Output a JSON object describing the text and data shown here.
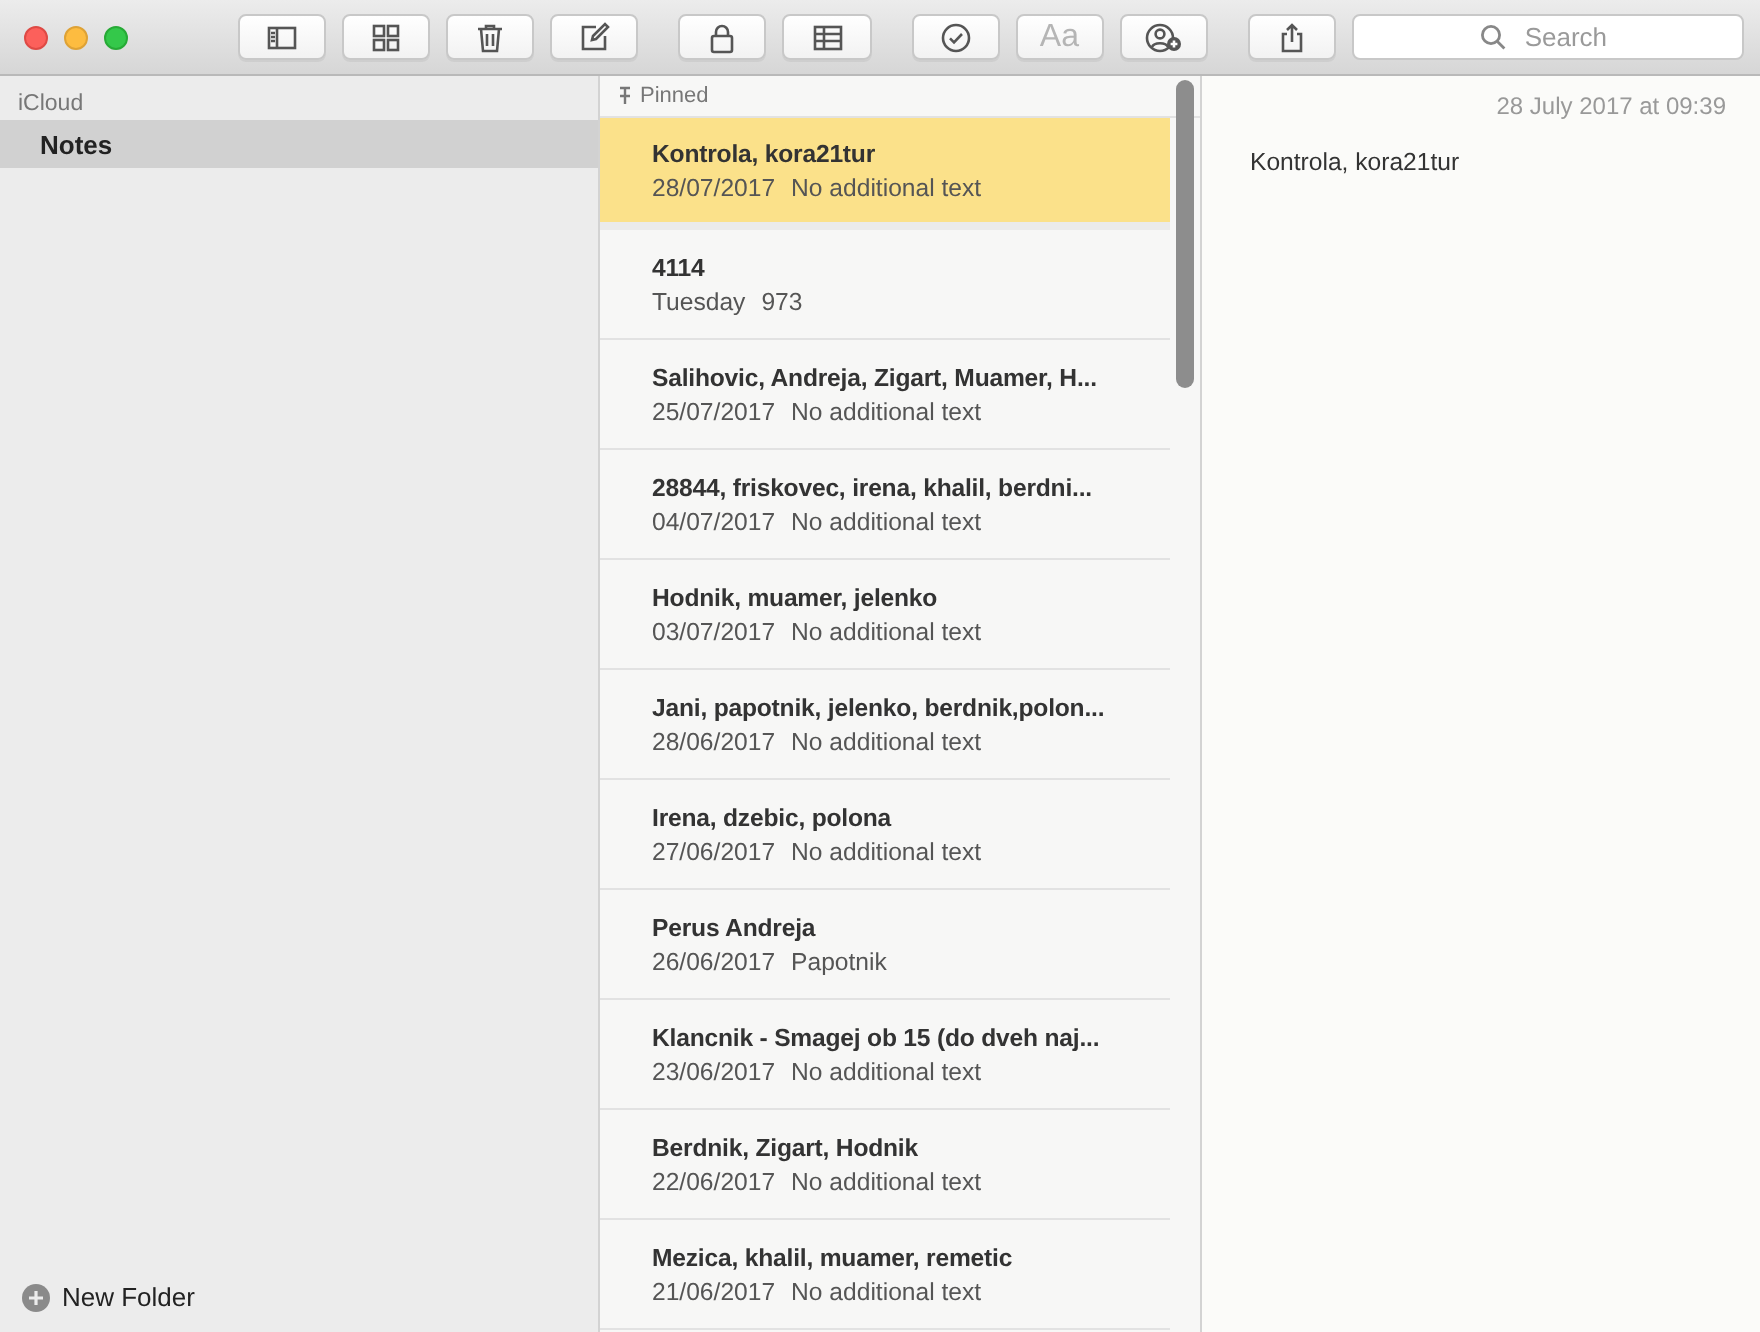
{
  "toolbar": {
    "buttons": [
      {
        "kind": "sidebar",
        "disabled": false
      },
      {
        "kind": "grid",
        "disabled": false
      },
      {
        "kind": "trash",
        "disabled": false
      },
      {
        "kind": "compose",
        "disabled": false
      },
      {
        "kind": "lock",
        "disabled": false
      },
      {
        "kind": "table",
        "disabled": false
      },
      {
        "kind": "checklist",
        "disabled": false
      },
      {
        "kind": "format",
        "label": "Aa",
        "disabled": true
      },
      {
        "kind": "people",
        "disabled": false
      },
      {
        "kind": "share",
        "disabled": false
      }
    ],
    "search": {
      "placeholder": "Search"
    }
  },
  "sidebar": {
    "account": "iCloud",
    "folders": [
      {
        "name": "Notes",
        "selected": true
      }
    ],
    "new_folder": "New Folder"
  },
  "note_list": {
    "pinned_header": "Pinned",
    "notes": [
      {
        "title": "Kontrola, kora21tur",
        "date": "28/07/2017",
        "preview": "No additional text",
        "selected": true,
        "pinned": true
      },
      {
        "title": "4114",
        "date": "Tuesday",
        "preview": "973",
        "selected": false,
        "pinned": false
      },
      {
        "title": "Salihovic, Andreja, Zigart, Muamer, H...",
        "date": "25/07/2017",
        "preview": "No additional text",
        "selected": false,
        "pinned": false
      },
      {
        "title": "28844, friskovec, irena, khalil, berdni...",
        "date": "04/07/2017",
        "preview": "No additional text",
        "selected": false,
        "pinned": false
      },
      {
        "title": "Hodnik, muamer, jelenko",
        "date": "03/07/2017",
        "preview": "No additional text",
        "selected": false,
        "pinned": false
      },
      {
        "title": "Jani, papotnik, jelenko, berdnik,polon...",
        "date": "28/06/2017",
        "preview": "No additional text",
        "selected": false,
        "pinned": false
      },
      {
        "title": "Irena, dzebic, polona",
        "date": "27/06/2017",
        "preview": "No additional text",
        "selected": false,
        "pinned": false
      },
      {
        "title": "Perus Andreja",
        "date": "26/06/2017",
        "preview": "Papotnik",
        "selected": false,
        "pinned": false
      },
      {
        "title": "Klancnik - Smagej ob 15 (do dveh naj...",
        "date": "23/06/2017",
        "preview": "No additional text",
        "selected": false,
        "pinned": false
      },
      {
        "title": "Berdnik, Zigart, Hodnik",
        "date": "22/06/2017",
        "preview": "No additional text",
        "selected": false,
        "pinned": false
      },
      {
        "title": "Mezica, khalil, muamer, remetic",
        "date": "21/06/2017",
        "preview": "No additional text",
        "selected": false,
        "pinned": false
      }
    ]
  },
  "editor": {
    "timestamp": "28 July 2017 at 09:39",
    "body": "Kontrola, kora21tur"
  }
}
